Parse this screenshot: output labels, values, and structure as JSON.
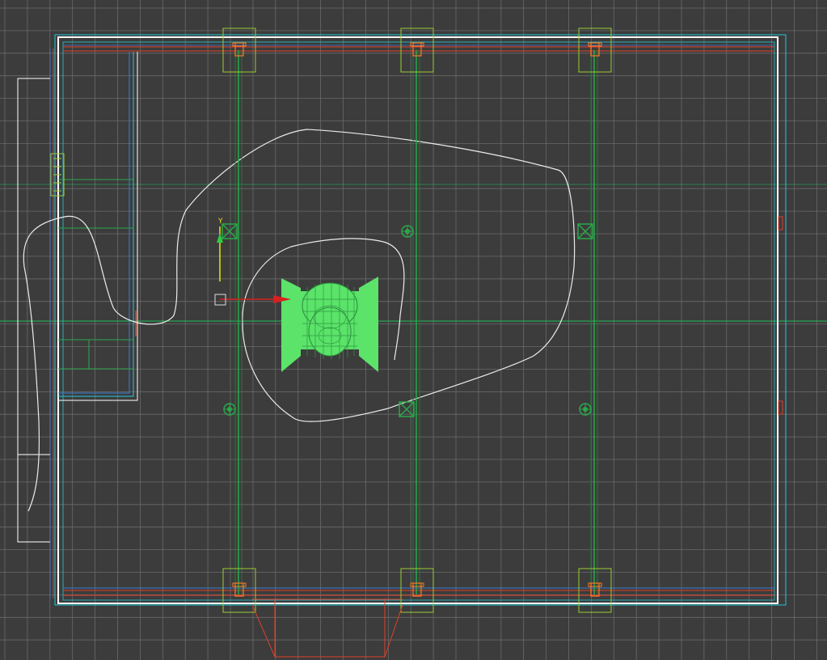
{
  "viewport": {
    "background": "#3c3c3c",
    "grid_color": "#6a6a6a",
    "axis_color": "#1fbf5a"
  },
  "gizmo": {
    "axis_label_y": "Y",
    "y_color": "#e6e60a",
    "x_color": "#d82020",
    "z_color": "#2ecc40"
  },
  "colors": {
    "wall_white": "#ffffff",
    "wall_cyan": "#22c8d8",
    "wall_red": "#e0402a",
    "beam_green": "#2aa84a",
    "column_box": "#9acd32",
    "selected_object": "#5be36a",
    "curve": "#ececec",
    "accent_orange": "#ff7a20"
  },
  "icons": [
    "move-gizmo-icon",
    "light-icon",
    "target-icon",
    "pivot-icon"
  ]
}
